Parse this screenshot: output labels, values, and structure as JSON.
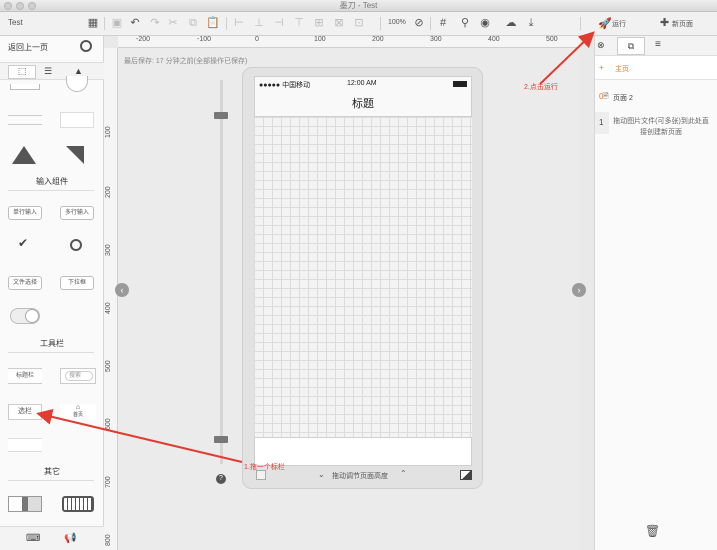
{
  "window": {
    "title": "墨刀 - Test"
  },
  "toolbar": {
    "project_name": "Test",
    "zoom": "100%",
    "run_label": "运行",
    "new_page_label": "新页面"
  },
  "left_panel": {
    "back_label": "返回上一页",
    "section_input": "输入组件",
    "single_line_input": "单行输入",
    "multi_line_input": "多行输入",
    "file_select": "文件选择",
    "dropdown": "下拉框",
    "section_toolbar": "工具栏",
    "title_bar": "标题栏",
    "search_placeholder": "搜索",
    "tab_bar": "选栏",
    "home_label": "首页",
    "section_other": "其它"
  },
  "canvas": {
    "save_status": "最后保存: 17 分钟之前(全部操作已保存)",
    "ruler_top": [
      "-200",
      "-100",
      "0",
      "100",
      "200",
      "300",
      "400",
      "500"
    ],
    "ruler_left": [
      "100",
      "200",
      "300",
      "400",
      "500",
      "600",
      "700",
      "800"
    ],
    "status_bar_carrier": "●●●●● 中国移动",
    "status_bar_time": "12:00 AM",
    "page_title": "标题",
    "drag_hint": "拖动调节页面高度",
    "annotation_drag": "1.拖一个标栏",
    "annotation_run": "2.点击运行"
  },
  "right_panel": {
    "pages": [
      {
        "num": "+",
        "label": "主页",
        "active": true
      },
      {
        "num": "0",
        "label": "页面 2",
        "active": false
      }
    ],
    "drop_hint_num": "1",
    "drop_hint": "拖动图片文件(可多张)到此处直接创建新页面"
  },
  "colors": {
    "accent": "#e8792b",
    "annotation": "#e23b30"
  }
}
